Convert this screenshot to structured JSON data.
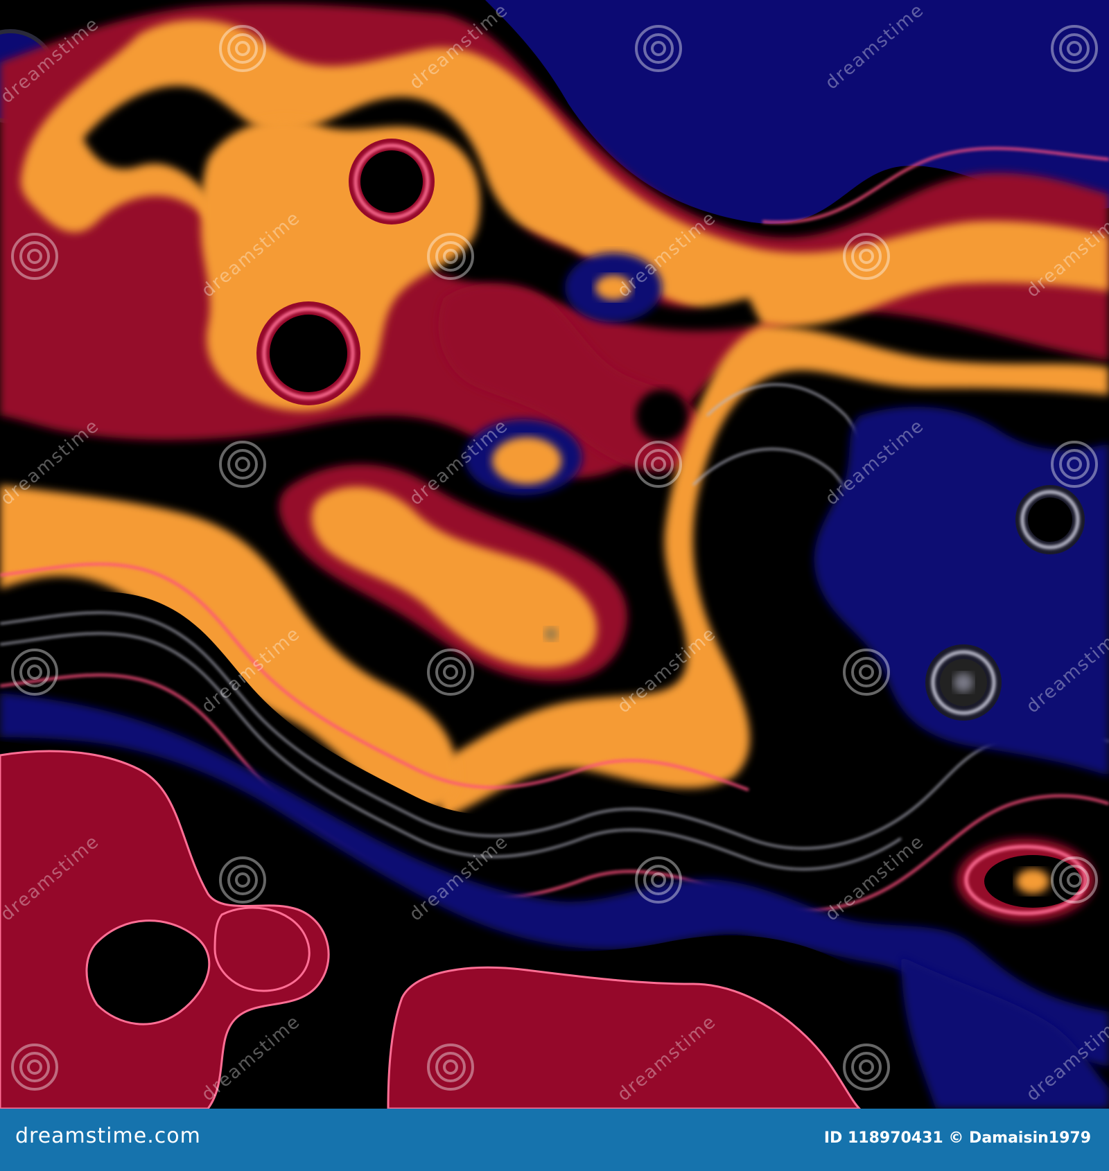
{
  "artwork": {
    "description_colors": {
      "navy": "#0c0a73",
      "orange": "#f59b35",
      "crimson": "#95082a",
      "black": "#000000",
      "pink_highlight": "#ff6f95",
      "silver": "#b7b7c6"
    },
    "watermark_text": "dreamstime"
  },
  "footer": {
    "logo_text": "dreamstime.com",
    "id_text": "ID 118970431 © Damaisin1979",
    "background": "#1673ad"
  }
}
